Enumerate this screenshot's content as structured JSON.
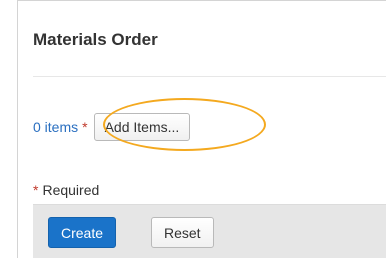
{
  "form": {
    "title": "Materials Order",
    "items_count_label": "0 items",
    "required_marker": "*",
    "add_items_label": "Add Items...",
    "required_note": "Required"
  },
  "actions": {
    "create_label": "Create",
    "reset_label": "Reset"
  },
  "colors": {
    "link": "#2a6fc0",
    "primary_button": "#1a73c9",
    "highlight": "#f4a91f",
    "required": "#c0392b"
  }
}
